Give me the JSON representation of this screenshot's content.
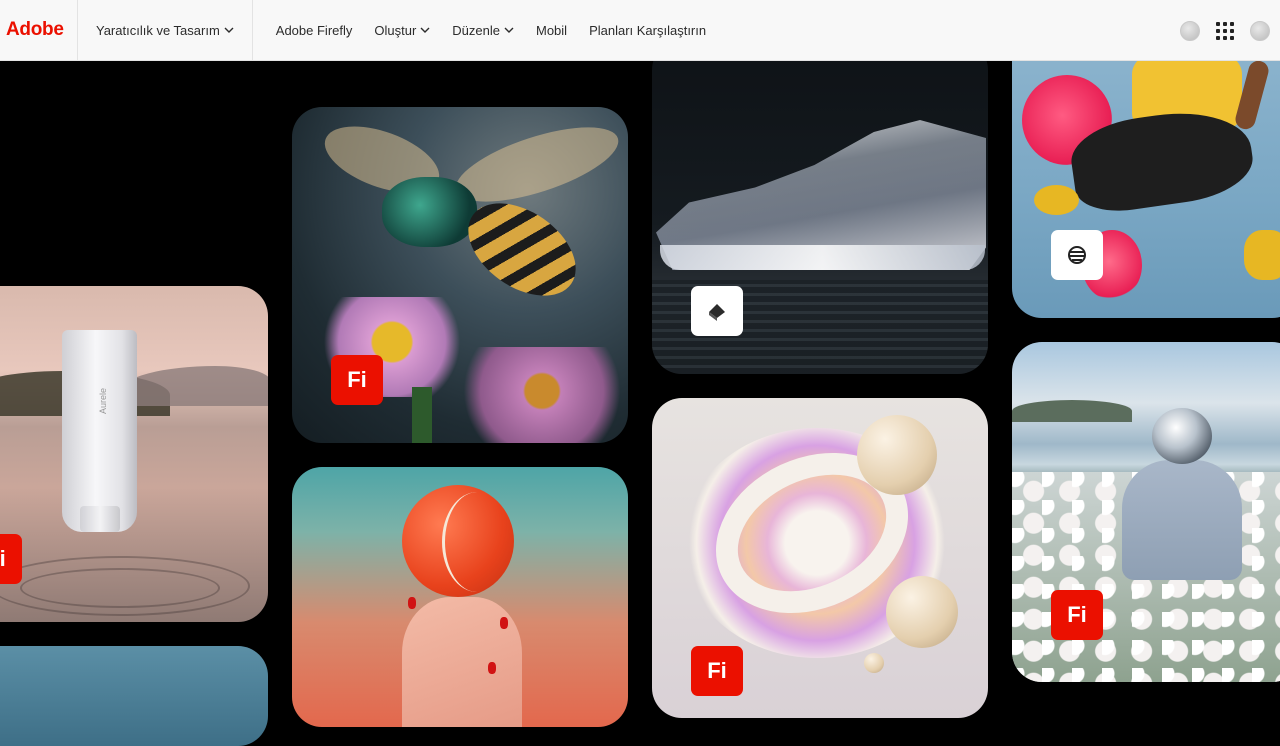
{
  "header": {
    "logo_text": "Adobe",
    "nav_first": "Yaratıcılık ve Tasarım",
    "nav_items": [
      {
        "label": "Adobe Firefly",
        "has_chevron": false
      },
      {
        "label": "Oluştur",
        "has_chevron": true
      },
      {
        "label": "Düzenle",
        "has_chevron": true
      },
      {
        "label": "Mobil",
        "has_chevron": false
      },
      {
        "label": "Planları Karşılaştırın",
        "has_chevron": false
      }
    ],
    "right_icons": [
      "profile-circle-icon",
      "apps-grid-icon",
      "avatar-icon"
    ]
  },
  "gallery": {
    "badge_fi": "Fi",
    "product_label": "Aurele",
    "cards": [
      {
        "name": "skincare-tube",
        "badge": "firefly"
      },
      {
        "name": "bee-on-flower",
        "badge": "firefly"
      },
      {
        "name": "tennis-ball-hand",
        "badge": "none"
      },
      {
        "name": "glass-sneaker",
        "badge": "substance-3d"
      },
      {
        "name": "abstract-ribbons",
        "badge": "firefly"
      },
      {
        "name": "jumping-person",
        "badge": "express"
      },
      {
        "name": "astronaut-roses",
        "badge": "firefly"
      }
    ]
  },
  "colors": {
    "brand_red": "#eb1000",
    "header_bg": "#f8f8f8",
    "page_bg": "#000000"
  }
}
